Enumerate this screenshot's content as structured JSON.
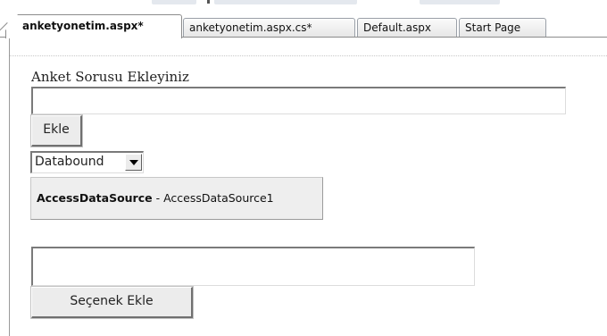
{
  "tabs": [
    {
      "label": "anketyonetim.aspx*",
      "active": true
    },
    {
      "label": "anketyonetim.aspx.cs*",
      "active": false
    },
    {
      "label": "Default.aspx",
      "active": false
    },
    {
      "label": "Start Page",
      "active": false
    }
  ],
  "form": {
    "question_label": "Anket Sorusu Ekleyiniz",
    "question_input_value": "",
    "add_button": "Ekle",
    "dropdown_value": "Databound",
    "datasource": {
      "type": "AccessDataSource",
      "separator": " - ",
      "id": "AccessDataSource1"
    },
    "option_input_value": "",
    "add_option_button": "Seçenek Ekle"
  },
  "colors": {
    "tab_border": "#8c8c8c",
    "button_face": "#ececec",
    "datasource_bg": "#eeeeee"
  }
}
